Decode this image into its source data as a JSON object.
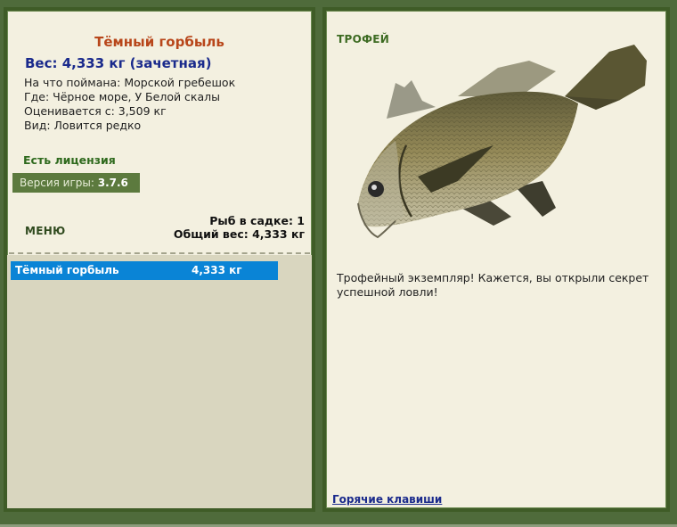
{
  "fish": {
    "name": "Тёмный горбыль",
    "weight_line": "Вес: 4,333 кг (зачетная)",
    "bait": "На что поймана: Морской гребешок",
    "place": "Где: Чёрное море, У Белой скалы",
    "value": "Оценивается с: 3,509 кг",
    "kind": "Вид: Ловится редко"
  },
  "license": "Есть лицензия",
  "version": {
    "label": "Версия игры:",
    "value": "3.7.6"
  },
  "menu_label": "МЕНЮ",
  "keep": {
    "count_line": "Рыб в садке: 1",
    "total_line": "Общий вес: 4,333 кг"
  },
  "catch_list": [
    {
      "name": "Тёмный горбыль",
      "weight": "4,333 кг"
    }
  ],
  "trophy": {
    "label": "ТРОФЕЙ",
    "text": "Трофейный экземпляр! Кажется, вы открыли секрет успешной ловли!"
  },
  "hotkeys_label": "Горячие клавиши",
  "colors": {
    "frame": "#3f5c27",
    "panel": "#f3f0e0",
    "selection": "#0a84d6",
    "title": "#b8461a",
    "weight": "#1a2a8c"
  },
  "icons": {
    "fish_image": "croaker-fish-image"
  }
}
